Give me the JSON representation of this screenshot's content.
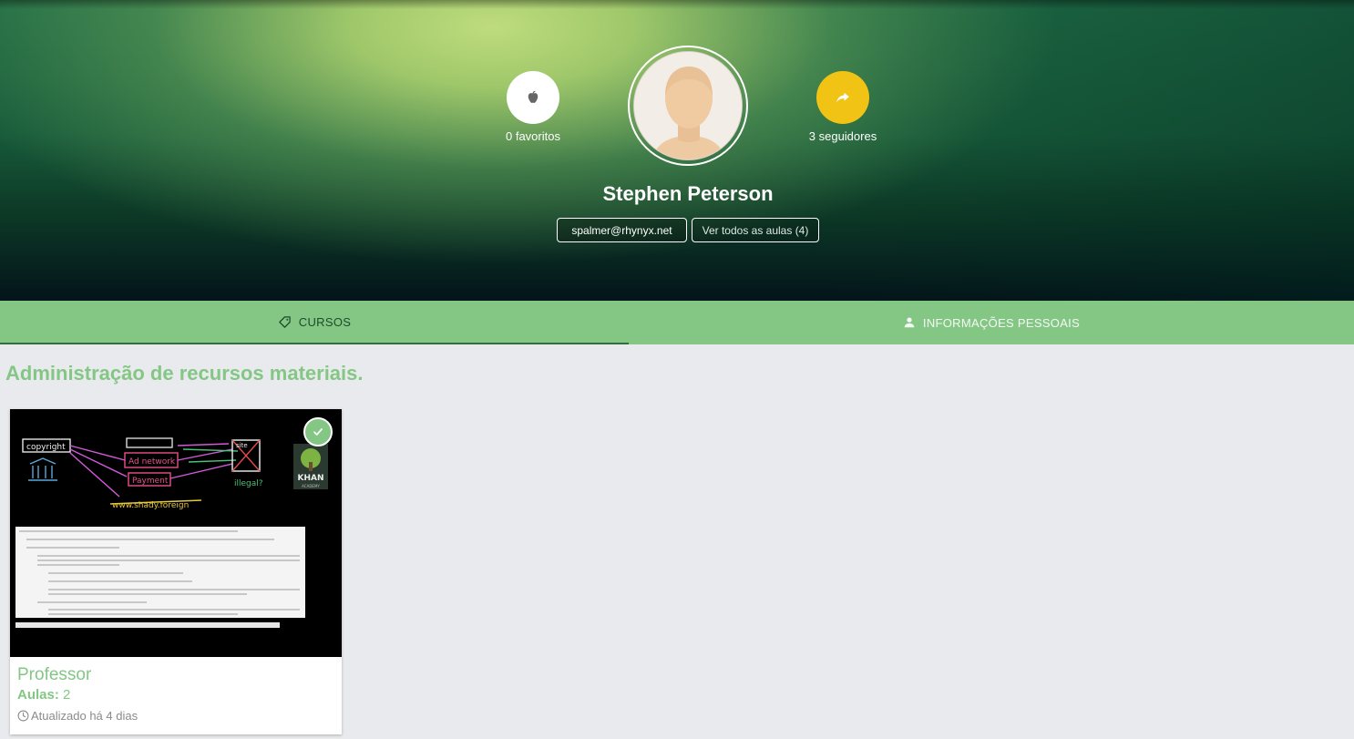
{
  "profile": {
    "name": "Stephen Peterson",
    "email": "spalmer@rhynyx.net",
    "view_all_label": "Ver todos as aulas (4)",
    "favorites_label": "0 favoritos",
    "followers_label": "3 seguidores"
  },
  "tabs": [
    {
      "label": "CURSOS",
      "icon": "tag-icon",
      "active": true
    },
    {
      "label": "INFORMAÇÕES PESSOAIS",
      "icon": "person-icon",
      "active": false
    }
  ],
  "section": {
    "title": "Administração de recursos materiais."
  },
  "course_card": {
    "title": "Professor",
    "lessons_label": "Aulas:",
    "lessons_count": "2",
    "updated": "Atualizado há 4 dias",
    "completed": true
  },
  "thumbnail": {
    "chalk_copyright": "copyright",
    "chalk_ad_network": "Ad network",
    "chalk_payment": "Payment",
    "chalk_url": "www.shady.foreign",
    "chalk_site": "site",
    "chalk_illegal": "illegal?",
    "logo_text": "KHAN",
    "logo_sub": "ACADEMY"
  },
  "colors": {
    "accent_green": "#84c785",
    "followers_yellow": "#f0c314",
    "tab_active_text": "#1d4b2a",
    "page_bg": "#e9eaed"
  }
}
